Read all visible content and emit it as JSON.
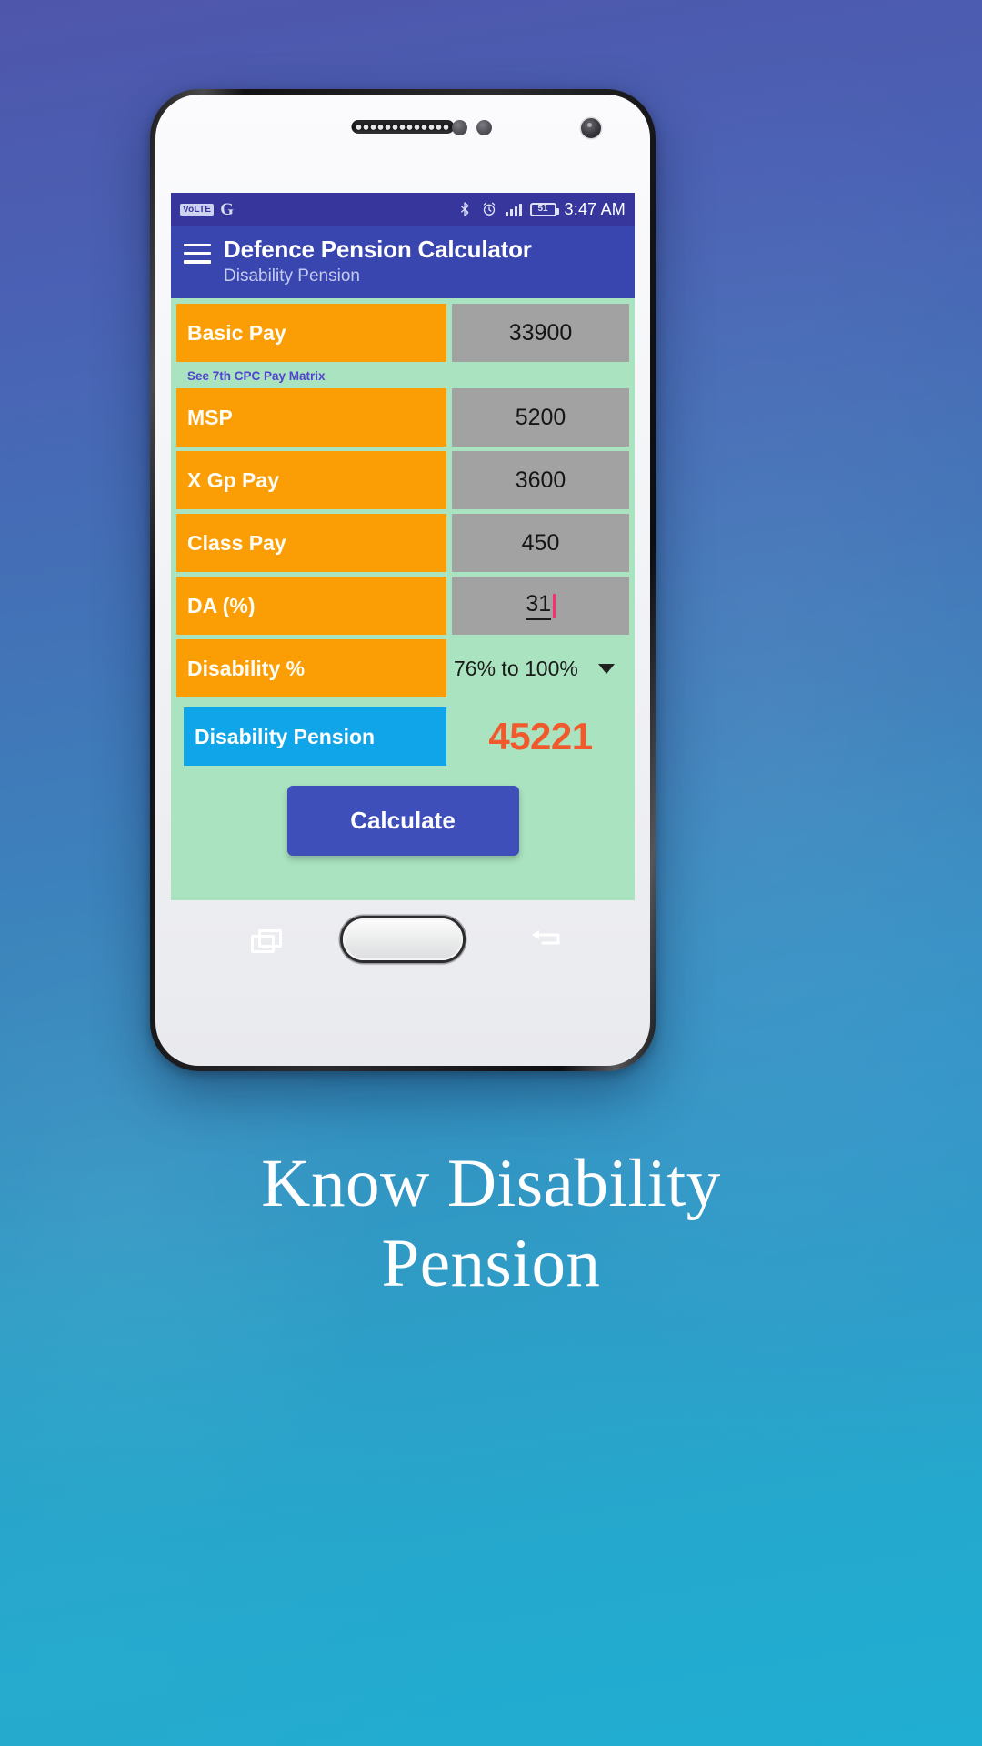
{
  "statusbar": {
    "volte": "VoLTE",
    "google_icon": "G",
    "bluetooth_icon": "bluetooth-icon",
    "alarm_icon": "alarm-icon",
    "signal_icon": "signal-bars-icon",
    "battery_level": "51",
    "time": "3:47 AM"
  },
  "appbar": {
    "menu_icon": "hamburger-menu-icon",
    "title": "Defence Pension Calculator",
    "subtitle": "Disability Pension"
  },
  "form": {
    "rows": [
      {
        "label": "Basic Pay",
        "value": "33900"
      },
      {
        "label": "MSP",
        "value": "5200"
      },
      {
        "label": "X Gp Pay",
        "value": "3600"
      },
      {
        "label": "Class Pay",
        "value": "450"
      }
    ],
    "matrix_link": "See 7th CPC Pay Matrix",
    "da": {
      "label": "DA (%)",
      "value": "31"
    },
    "disability": {
      "label": "Disability %",
      "selected": "76% to 100%",
      "options": [
        "76% to 100%"
      ]
    },
    "result": {
      "label": "Disability Pension",
      "value": "45221"
    },
    "calculate_label": "Calculate"
  },
  "navbar": {
    "recents_icon": "recents-icon",
    "home_button": "home-button",
    "back_icon": "back-icon"
  },
  "caption": {
    "line1": "Know Disability",
    "line2": "Pension"
  },
  "colors": {
    "accent_orange": "#fb9e06",
    "value_gray": "#a2a2a2",
    "screen_green": "#a9e3bf",
    "appbar_blue": "#3a46b0",
    "statusbar_blue": "#36369c",
    "result_orange": "#f05a2d",
    "result_label_blue": "#10a4e8",
    "button_blue": "#3f4fba",
    "link_purple": "#5242cf"
  }
}
